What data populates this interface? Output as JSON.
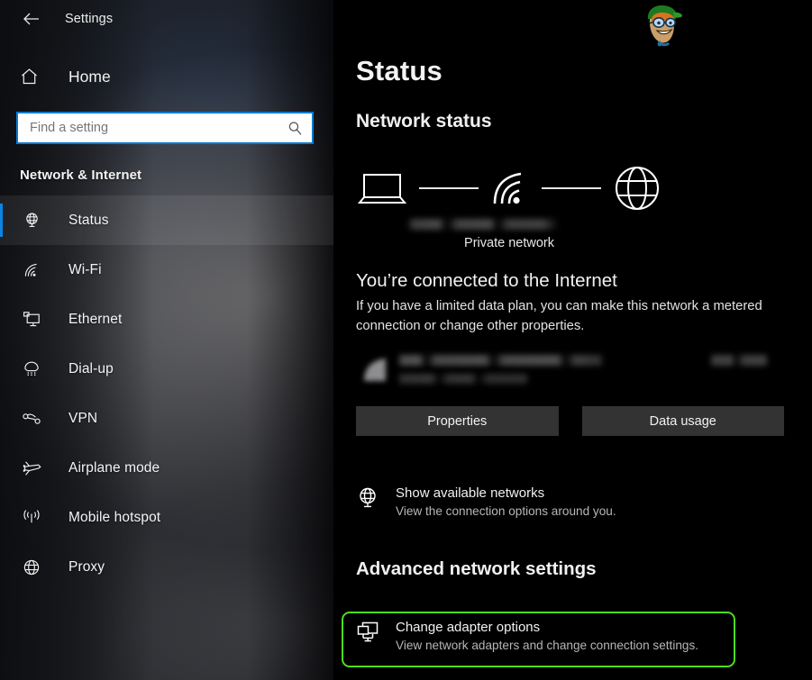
{
  "window": {
    "title": "Settings",
    "back_icon": "back-arrow-icon"
  },
  "sidebar": {
    "home": {
      "label": "Home",
      "icon": "home-icon"
    },
    "search": {
      "placeholder": "Find a setting",
      "value": "",
      "icon": "search-icon"
    },
    "category_heading": "Network & Internet",
    "items": [
      {
        "label": "Status",
        "icon": "globe-monitor-icon",
        "selected": true
      },
      {
        "label": "Wi-Fi",
        "icon": "wifi-icon",
        "selected": false
      },
      {
        "label": "Ethernet",
        "icon": "ethernet-icon",
        "selected": false
      },
      {
        "label": "Dial-up",
        "icon": "dialup-phone-icon",
        "selected": false
      },
      {
        "label": "VPN",
        "icon": "vpn-icon",
        "selected": false
      },
      {
        "label": "Airplane mode",
        "icon": "airplane-icon",
        "selected": false
      },
      {
        "label": "Mobile hotspot",
        "icon": "hotspot-icon",
        "selected": false
      },
      {
        "label": "Proxy",
        "icon": "globe-icon",
        "selected": false
      }
    ]
  },
  "main": {
    "page_title": "Status",
    "network_status_heading": "Network status",
    "network_map": {
      "device_icon": "laptop-icon",
      "link_icon": "wifi-signal-icon",
      "internet_icon": "globe-icon",
      "ssid_redacted": true,
      "network_type": "Private network"
    },
    "connection": {
      "heading": "You’re connected to the Internet",
      "description": "If you have a limited data plan, you can make this network a metered connection or change other properties."
    },
    "usage": {
      "adapter_icon": "wifi-signal-icon",
      "name_redacted": true,
      "period_redacted": true,
      "amount_redacted": true
    },
    "buttons": {
      "properties": "Properties",
      "data_usage": "Data usage"
    },
    "links": [
      {
        "title": "Show available networks",
        "subtitle": "View the connection options around you.",
        "icon": "globe-monitor-icon"
      }
    ],
    "advanced_heading": "Advanced network settings",
    "adapter_options": {
      "title": "Change adapter options",
      "subtitle": "View network adapters and change connection settings.",
      "icon": "adapter-monitor-icon",
      "highlighted": true
    },
    "watermark": {
      "icon": "mascot-logo-icon"
    }
  },
  "colors": {
    "accent_blue": "#0a7ad1",
    "selection_blue": "#0a84e4",
    "highlight_green": "#4fdc1f",
    "button_gray": "#333333",
    "main_background": "#000000"
  }
}
